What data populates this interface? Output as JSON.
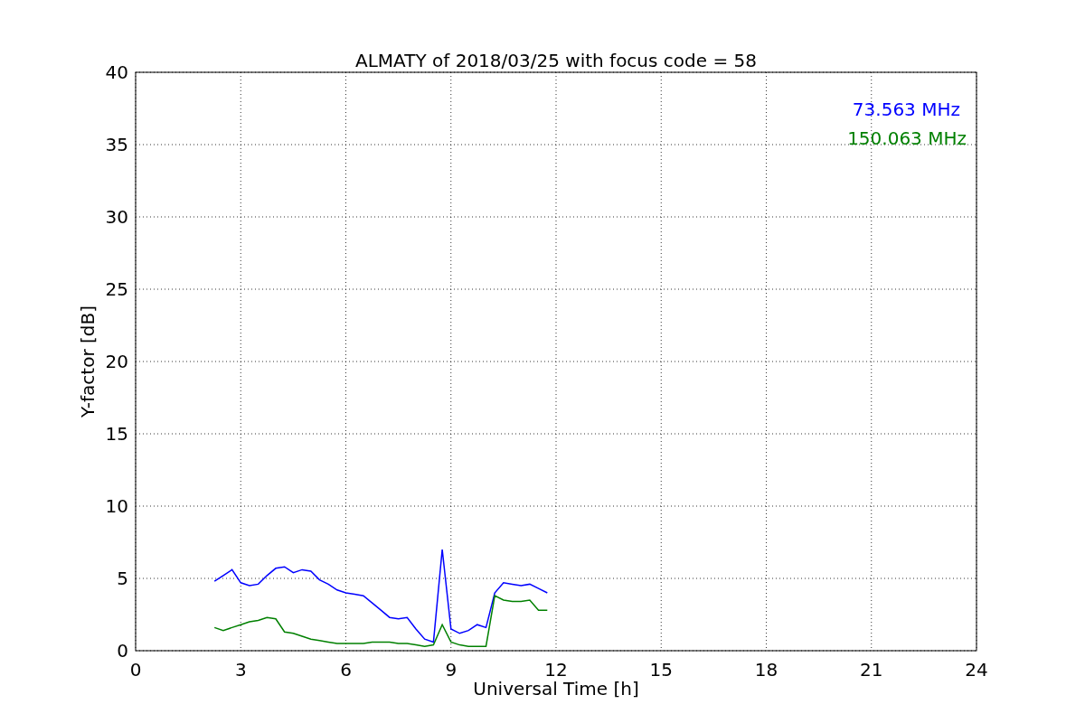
{
  "chart_data": {
    "type": "line",
    "title": "ALMATY of 2018/03/25 with focus code = 58",
    "xlabel": "Universal Time [h]",
    "ylabel": "Y-factor [dB]",
    "x": [
      2.25,
      2.5,
      2.75,
      3.0,
      3.25,
      3.5,
      3.75,
      4.0,
      4.25,
      4.5,
      4.75,
      5.0,
      5.25,
      5.5,
      5.75,
      6.0,
      6.25,
      6.5,
      6.75,
      7.0,
      7.25,
      7.5,
      7.75,
      8.0,
      8.25,
      8.5,
      8.75,
      9.0,
      9.25,
      9.5,
      9.75,
      10.0,
      10.25,
      10.5,
      10.75,
      11.0,
      11.25,
      11.5,
      11.75
    ],
    "series": [
      {
        "name": "73.563 MHz",
        "color": "#0000ff",
        "values": [
          4.8,
          5.2,
          5.6,
          4.7,
          4.5,
          4.6,
          5.2,
          5.7,
          5.8,
          5.4,
          5.6,
          5.5,
          4.9,
          4.6,
          4.2,
          4.0,
          3.9,
          3.8,
          3.3,
          2.8,
          2.3,
          2.2,
          2.3,
          1.5,
          0.8,
          0.6,
          7.0,
          1.5,
          1.2,
          1.4,
          1.8,
          1.6,
          4.0,
          4.7,
          4.6,
          4.5,
          4.6,
          4.3,
          4.0
        ]
      },
      {
        "name": "150.063 MHz",
        "color": "#008000",
        "values": [
          1.6,
          1.4,
          1.6,
          1.8,
          2.0,
          2.1,
          2.3,
          2.2,
          1.3,
          1.2,
          1.0,
          0.8,
          0.7,
          0.6,
          0.5,
          0.5,
          0.5,
          0.5,
          0.6,
          0.6,
          0.6,
          0.5,
          0.5,
          0.4,
          0.3,
          0.4,
          1.8,
          0.6,
          0.4,
          0.3,
          0.3,
          0.3,
          3.8,
          3.5,
          3.4,
          3.4,
          3.5,
          2.8,
          2.8
        ]
      }
    ],
    "xlim": [
      0,
      24
    ],
    "ylim": [
      0,
      40
    ],
    "xticks": [
      0,
      3,
      6,
      9,
      12,
      15,
      18,
      21,
      24
    ],
    "yticks": [
      0,
      5,
      10,
      15,
      20,
      25,
      30,
      35,
      40
    ],
    "grid": true
  }
}
